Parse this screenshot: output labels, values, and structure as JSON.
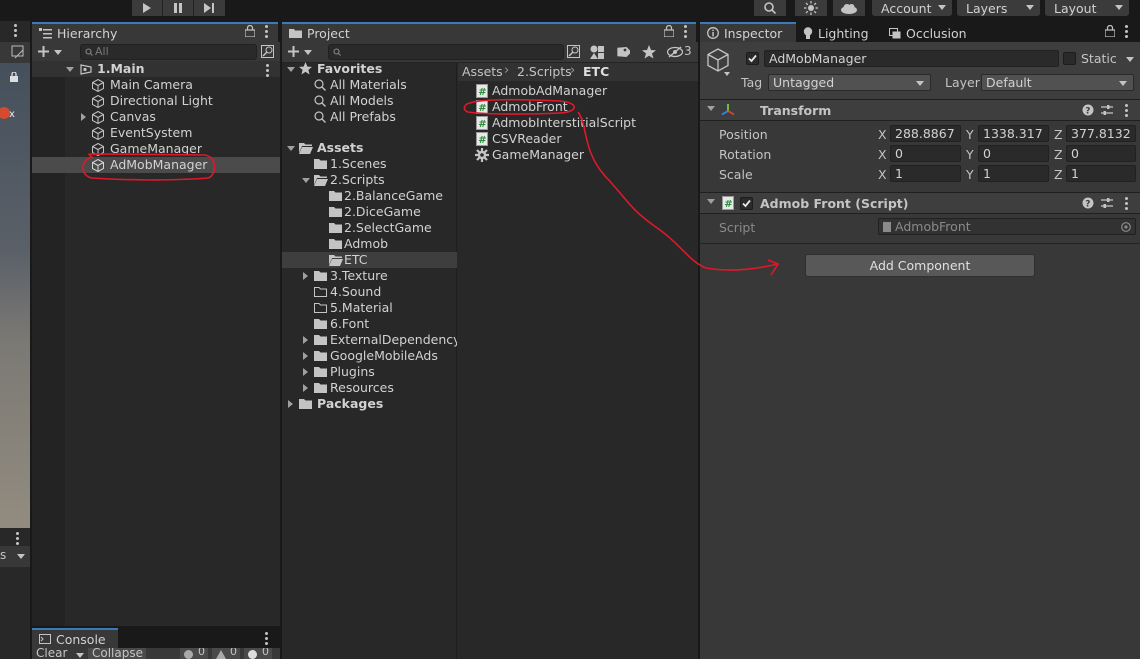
{
  "toolbar": {
    "account_label": "Account",
    "layers_label": "Layers",
    "layout_label": "Layout"
  },
  "hierarchy": {
    "tab_label": "Hierarchy",
    "search_placeholder": "All",
    "scene_name": "1.Main",
    "items": [
      "Main Camera",
      "Directional Light",
      "Canvas",
      "EventSystem",
      "GameManager",
      "AdMobManager"
    ]
  },
  "project": {
    "tab_label": "Project",
    "hidden_count": "3",
    "favorites": {
      "label": "Favorites",
      "items": [
        "All Materials",
        "All Models",
        "All Prefabs"
      ]
    },
    "assets": {
      "label": "Assets",
      "folders": [
        "1.Scenes",
        "2.Scripts",
        "2.BalanceGame",
        "2.DiceGame",
        "2.SelectGame",
        "Admob",
        "ETC",
        "3.Texture",
        "4.Sound",
        "5.Material",
        "6.Font",
        "ExternalDependencyM",
        "GoogleMobileAds",
        "Plugins",
        "Resources"
      ]
    },
    "packages_label": "Packages",
    "breadcrumb": [
      "Assets",
      "2.Scripts",
      "ETC"
    ],
    "files": [
      "AdmobAdManager",
      "AdmobFront",
      "AdmobInterstitialScript",
      "CSVReader",
      "GameManager"
    ]
  },
  "inspector": {
    "tabs": [
      "Inspector",
      "Lighting",
      "Occlusion"
    ],
    "object_name": "AdMobManager",
    "static_label": "Static",
    "tag_label": "Tag",
    "tag_value": "Untagged",
    "layer_label": "Layer",
    "layer_value": "Default",
    "transform": {
      "title": "Transform",
      "position_label": "Position",
      "rotation_label": "Rotation",
      "scale_label": "Scale",
      "position": {
        "x": "288.8867",
        "y": "1338.317",
        "z": "377.8132"
      },
      "rotation": {
        "x": "0",
        "y": "0",
        "z": "0"
      },
      "scale": {
        "x": "1",
        "y": "1",
        "z": "1"
      },
      "axis": {
        "x": "X",
        "y": "Y",
        "z": "Z"
      }
    },
    "component": {
      "title": "Admob Front (Script)",
      "script_label": "Script",
      "script_value": "AdmobFront"
    },
    "add_component_label": "Add Component"
  },
  "console": {
    "tab_label": "Console",
    "clear_label": "Clear",
    "collapse_label": "Collapse",
    "log_count": "0",
    "warn_count": "0",
    "error_count": "0"
  },
  "scene_view": {
    "dropdown_label": "s"
  },
  "colors": {
    "selection": "#4b4b4b",
    "accent": "#3a79bb",
    "annotation": "#e0182a"
  }
}
